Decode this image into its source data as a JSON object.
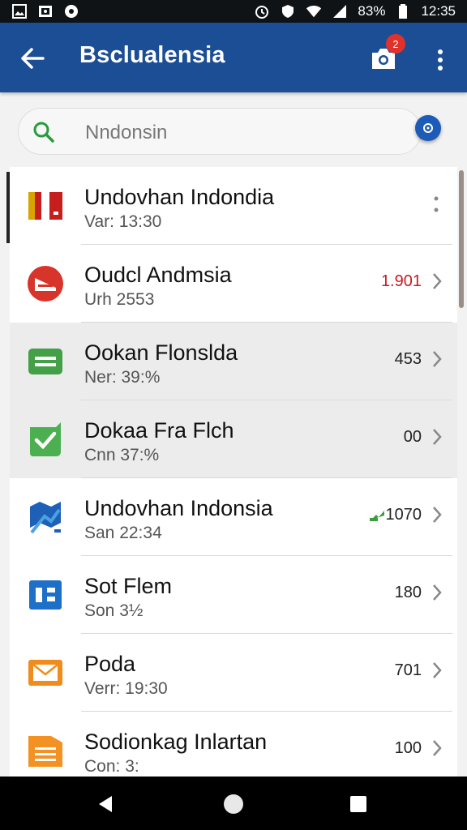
{
  "status_bar": {
    "left_icons": [
      "image-icon",
      "photo-gallery-icon",
      "circle-notification-icon"
    ],
    "right_icons": [
      "alarm-icon",
      "shield-icon",
      "wifi-icon",
      "signal-icon"
    ],
    "battery_text": "83%",
    "time": "12:35"
  },
  "app_bar": {
    "title": "Bsclualensia",
    "badge_count": "2",
    "colors": {
      "bar": "#1c4e95",
      "badge": "#e0322a"
    }
  },
  "search": {
    "value": "Nndonsin",
    "placeholder": ""
  },
  "list": {
    "items": [
      {
        "title": "Undovhan Indondia",
        "subtitle": "Var: 13:30",
        "value": "",
        "icon": "red-flag-icon",
        "trailing": "kebab"
      },
      {
        "title": "Oudcl Andmsia",
        "subtitle": "Urh 2553",
        "value": "1.901",
        "value_color": "red",
        "icon": "red-badge-icon",
        "trailing": "chevron"
      },
      {
        "title": "Ookan Flonslda",
        "subtitle": "Ner: 39:%",
        "value": "453",
        "icon": "green-card-icon",
        "trailing": "chevron"
      },
      {
        "title": "Dokaa Fra Flch",
        "subtitle": "Cnn 37:%",
        "value": "00",
        "icon": "green-check-icon",
        "trailing": "chevron"
      },
      {
        "title": "Undovhan Indonsia",
        "subtitle": "San 22:34",
        "value": "1070",
        "trend": "up",
        "icon": "blue-map-icon",
        "trailing": "chevron"
      },
      {
        "title": "Sot Flem",
        "subtitle": "Son 3½",
        "value": "180",
        "icon": "blue-grid-icon",
        "trailing": "chevron"
      },
      {
        "title": "Poda",
        "subtitle": "Verr: 19:30",
        "value": "701",
        "icon": "orange-mail-icon",
        "trailing": "chevron"
      },
      {
        "title": "Sodionkag Inlartan",
        "subtitle": "Con: 3:",
        "value": "100",
        "icon": "orange-list-icon",
        "trailing": "chevron"
      }
    ]
  },
  "nav_bar": {
    "buttons": [
      "back-triangle-icon",
      "home-circle-icon",
      "recents-square-icon"
    ]
  }
}
